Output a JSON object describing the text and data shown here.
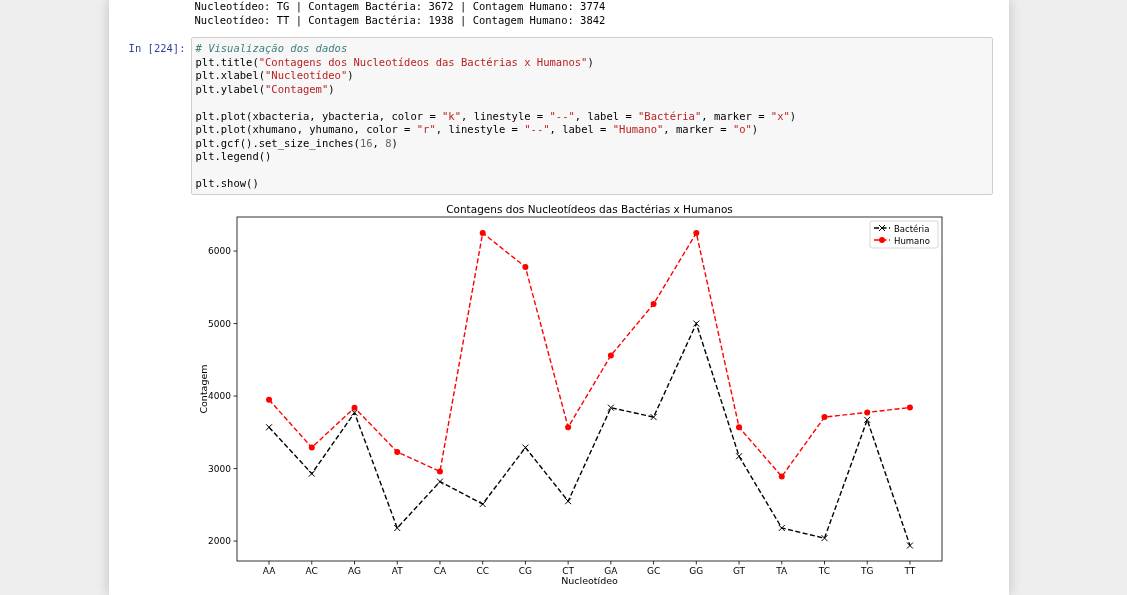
{
  "output_lines": [
    "Nucleotídeo: TG | Contagem Bactéria: 3672 | Contagem Humano: 3774",
    "Nucleotídeo: TT | Contagem Bactéria: 1938 | Contagem Humano: 3842"
  ],
  "cell": {
    "prompt": "In [224]:",
    "lines": [
      {
        "kind": "code",
        "tokens": [
          {
            "kind": "comment",
            "text": "# Visualização dos dados"
          }
        ]
      },
      {
        "kind": "code",
        "tokens": [
          {
            "kind": "plain",
            "text": "plt.title("
          },
          {
            "kind": "string",
            "text": "\"Contagens dos Nucleotídeos das Bactérias x Humanos\""
          },
          {
            "kind": "plain",
            "text": ")"
          }
        ]
      },
      {
        "kind": "code",
        "tokens": [
          {
            "kind": "plain",
            "text": "plt.xlabel("
          },
          {
            "kind": "string",
            "text": "\"Nucleotídeo\""
          },
          {
            "kind": "plain",
            "text": ")"
          }
        ]
      },
      {
        "kind": "code",
        "tokens": [
          {
            "kind": "plain",
            "text": "plt.ylabel("
          },
          {
            "kind": "string",
            "text": "\"Contagem\""
          },
          {
            "kind": "plain",
            "text": ")"
          }
        ]
      },
      {
        "kind": "blank"
      },
      {
        "kind": "code",
        "tokens": [
          {
            "kind": "plain",
            "text": "plt.plot(xbacteria, ybacteria, color = "
          },
          {
            "kind": "string",
            "text": "\"k\""
          },
          {
            "kind": "plain",
            "text": ", linestyle = "
          },
          {
            "kind": "string",
            "text": "\"--\""
          },
          {
            "kind": "plain",
            "text": ", label = "
          },
          {
            "kind": "string",
            "text": "\"Bactéria\""
          },
          {
            "kind": "plain",
            "text": ", marker = "
          },
          {
            "kind": "string",
            "text": "\"x\""
          },
          {
            "kind": "plain",
            "text": ")"
          }
        ]
      },
      {
        "kind": "code",
        "tokens": [
          {
            "kind": "plain",
            "text": "plt.plot(xhumano, yhumano, color = "
          },
          {
            "kind": "string",
            "text": "\"r\""
          },
          {
            "kind": "plain",
            "text": ", linestyle = "
          },
          {
            "kind": "string",
            "text": "\"--\""
          },
          {
            "kind": "plain",
            "text": ", label = "
          },
          {
            "kind": "string",
            "text": "\"Humano\""
          },
          {
            "kind": "plain",
            "text": ", marker = "
          },
          {
            "kind": "string",
            "text": "\"o\""
          },
          {
            "kind": "plain",
            "text": ")"
          }
        ]
      },
      {
        "kind": "code",
        "tokens": [
          {
            "kind": "plain",
            "text": "plt.gcf().set_size_inches("
          },
          {
            "kind": "number",
            "text": "16"
          },
          {
            "kind": "plain",
            "text": ", "
          },
          {
            "kind": "number",
            "text": "8"
          },
          {
            "kind": "plain",
            "text": ")"
          }
        ]
      },
      {
        "kind": "code",
        "tokens": [
          {
            "kind": "plain",
            "text": "plt.legend()"
          }
        ]
      },
      {
        "kind": "blank"
      },
      {
        "kind": "code",
        "tokens": [
          {
            "kind": "plain",
            "text": "plt.show()"
          }
        ]
      }
    ]
  },
  "chart_data": {
    "type": "line",
    "title": "Contagens dos Nucleotídeos das Bactérias x Humanos",
    "xlabel": "Nucleotídeo",
    "ylabel": "Contagem",
    "categories": [
      "AA",
      "AC",
      "AG",
      "AT",
      "CA",
      "CC",
      "CG",
      "CT",
      "GA",
      "GC",
      "GG",
      "GT",
      "TA",
      "TC",
      "TG",
      "TT"
    ],
    "series": [
      {
        "name": "Bactéria",
        "color": "#000000",
        "marker": "x",
        "line_style": "dashed",
        "values": [
          3570,
          2930,
          3770,
          2180,
          2820,
          2510,
          3290,
          2550,
          3840,
          3710,
          5000,
          3170,
          2180,
          2040,
          3672,
          1938
        ]
      },
      {
        "name": "Humano",
        "color": "#ff0000",
        "marker": "o",
        "line_style": "dashed",
        "values": [
          3950,
          3290,
          3840,
          3230,
          2960,
          6250,
          5780,
          3570,
          4560,
          5270,
          6250,
          3570,
          2890,
          3710,
          3774,
          3842
        ]
      }
    ],
    "legend": true,
    "ylim": [
      1725,
      6470
    ],
    "yticks": [
      2000,
      3000,
      4000,
      5000,
      6000
    ]
  }
}
